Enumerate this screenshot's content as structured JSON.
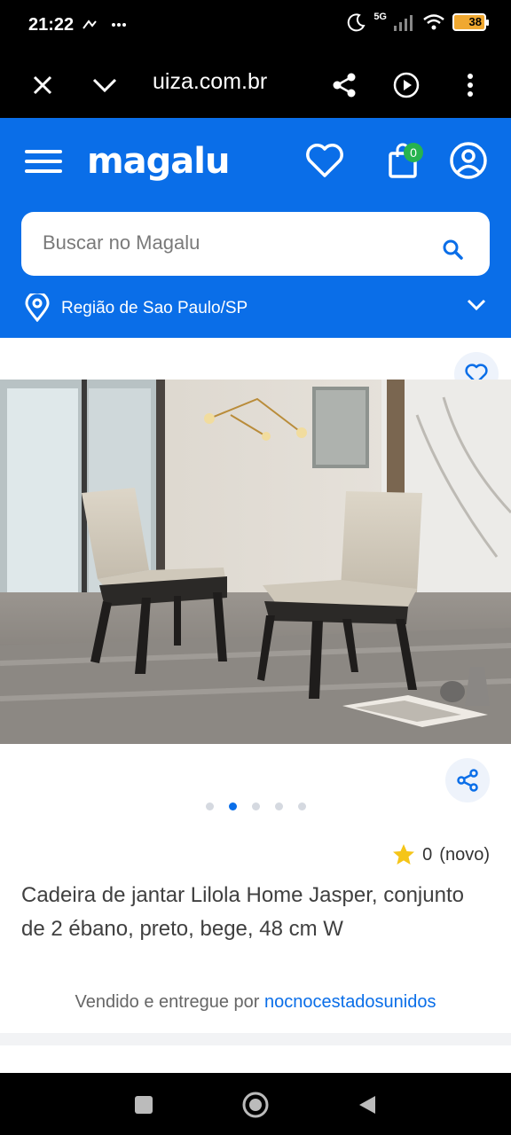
{
  "status": {
    "time": "21:22",
    "left_icons": "⸻",
    "network": "5G",
    "battery": "38"
  },
  "browser": {
    "url": "uiza.com.br"
  },
  "header": {
    "logo": "magalu",
    "cart_count": "0"
  },
  "search": {
    "placeholder": "Buscar no Magalu"
  },
  "region": {
    "label": "Região de Sao Paulo/SP"
  },
  "product": {
    "rating_value": "0",
    "rating_note": "(novo)",
    "title": "Cadeira de jantar Lilola Home Jasper, conjunto de 2 ébano, preto, bege, 48 cm W",
    "seller_prefix": "Vendido e entregue por",
    "seller_name": "nocnocestadosunidos",
    "carousel_count": 5,
    "carousel_active": 2
  },
  "colors": {
    "brand_blue": "#0a6ee8",
    "cart_badge": "#27b34f",
    "star": "#f5c518"
  },
  "icons": [
    "close-icon",
    "chevron-down-icon",
    "share-icon",
    "play-icon",
    "more-icon",
    "menu-icon",
    "heart-icon",
    "bag-icon",
    "user-icon",
    "search-icon",
    "location-pin-icon",
    "star-icon"
  ]
}
